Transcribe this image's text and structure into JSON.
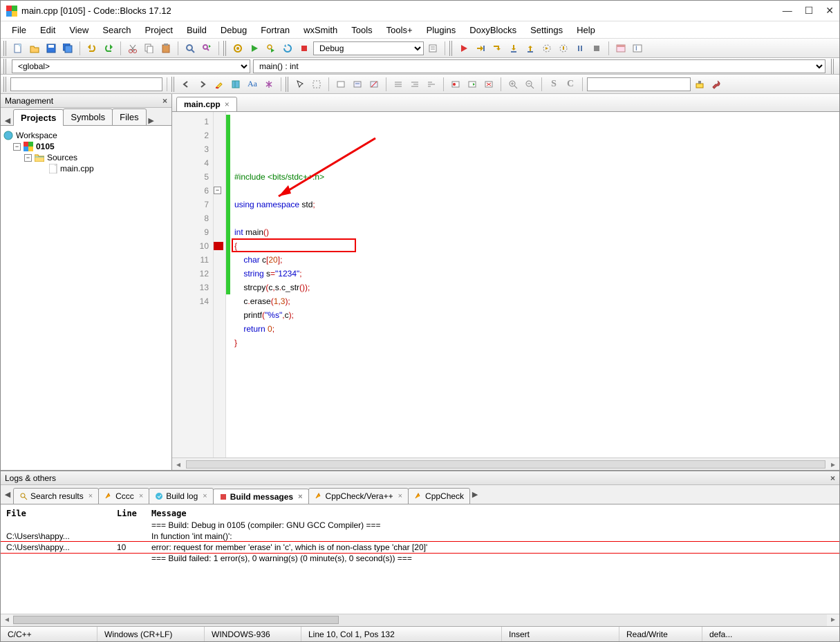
{
  "window": {
    "title": "main.cpp [0105] - Code::Blocks 17.12"
  },
  "menu": [
    "File",
    "Edit",
    "View",
    "Search",
    "Project",
    "Build",
    "Debug",
    "Fortran",
    "wxSmith",
    "Tools",
    "Tools+",
    "Plugins",
    "DoxyBlocks",
    "Settings",
    "Help"
  ],
  "build_config": "Debug",
  "scope": {
    "left": "<global>",
    "right": "main() : int"
  },
  "management": {
    "title": "Management",
    "tabs": [
      "Projects",
      "Symbols",
      "Files"
    ],
    "active_tab": 0,
    "tree": {
      "workspace": "Workspace",
      "project": "0105",
      "folder": "Sources",
      "file": "main.cpp"
    }
  },
  "editor": {
    "tab": "main.cpp",
    "lines": [
      {
        "n": 1,
        "chg": "g",
        "html": "<span class='pp'>#include &lt;bits/stdc++.h&gt;</span>"
      },
      {
        "n": 2,
        "chg": "g",
        "html": ""
      },
      {
        "n": 3,
        "chg": "g",
        "html": "<span class='kw'>using</span> <span class='kw'>namespace</span> std<span class='op'>;</span>"
      },
      {
        "n": 4,
        "chg": "g",
        "html": ""
      },
      {
        "n": 5,
        "chg": "g",
        "html": "<span class='kw'>int</span> main<span class='op'>()</span>"
      },
      {
        "n": 6,
        "chg": "g",
        "html": "<span class='op'>{</span>"
      },
      {
        "n": 7,
        "chg": "g",
        "html": "    <span class='kw'>char</span> c<span class='op'>[</span><span class='nm'>20</span><span class='op'>];</span>"
      },
      {
        "n": 8,
        "chg": "g",
        "html": "    <span class='kw'>string</span> s<span class='op'>=</span><span class='st'>\"1234\"</span><span class='op'>;</span>"
      },
      {
        "n": 9,
        "chg": "g",
        "html": "    strcpy<span class='op'>(</span>c<span class='op'>,</span>s<span class='op'>.</span>c_str<span class='op'>());</span>"
      },
      {
        "n": 10,
        "chg": "g",
        "mark": "err",
        "html": "    c<span class='op'>.</span>erase<span class='op'>(</span><span class='nm'>1</span><span class='op'>,</span><span class='nm'>3</span><span class='op'>);</span>"
      },
      {
        "n": 11,
        "chg": "g",
        "html": "    printf<span class='op'>(</span><span class='st'>\"%s\"</span><span class='op'>,</span>c<span class='op'>);</span>"
      },
      {
        "n": 12,
        "chg": "g",
        "html": "    <span class='kw'>return</span> <span class='nm'>0</span><span class='op'>;</span>"
      },
      {
        "n": 13,
        "chg": "g",
        "html": "<span class='op'>}</span>"
      },
      {
        "n": 14,
        "chg": "",
        "html": ""
      }
    ]
  },
  "logs": {
    "title": "Logs & others",
    "tabs": [
      "Search results",
      "Cccc",
      "Build log",
      "Build messages",
      "CppCheck/Vera++",
      "CppCheck"
    ],
    "active_tab": 3,
    "columns": [
      "File",
      "Line",
      "Message"
    ],
    "rows": [
      {
        "file": "",
        "line": "",
        "msg": "=== Build: Debug in 0105 (compiler: GNU GCC Compiler) ==="
      },
      {
        "file": "C:\\Users\\happy...",
        "line": "",
        "msg": "In function 'int main()':"
      },
      {
        "file": "C:\\Users\\happy...",
        "line": "10",
        "msg": "error: request for member 'erase' in 'c', which is of non-class type 'char [20]'",
        "err": true
      },
      {
        "file": "",
        "line": "",
        "msg": "=== Build failed: 1 error(s), 0 warning(s) (0 minute(s), 0 second(s)) ==="
      }
    ]
  },
  "status": {
    "lang": "C/C++",
    "eol": "Windows (CR+LF)",
    "enc": "WINDOWS-936",
    "pos": "Line 10, Col 1, Pos 132",
    "mode": "Insert",
    "rw": "Read/Write",
    "extra": "defa..."
  },
  "letters": {
    "s": "S",
    "c": "C"
  }
}
